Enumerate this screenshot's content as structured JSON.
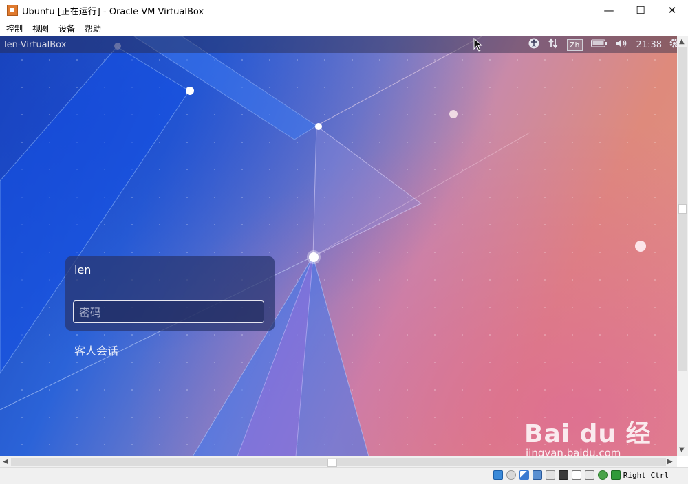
{
  "window": {
    "title": "Ubuntu [正在运行] - Oracle VM VirtualBox",
    "minimize_glyph": "—",
    "maximize_glyph": "☐",
    "close_glyph": "✕",
    "app_icon": "virtualbox-icon"
  },
  "menubar": {
    "items": [
      {
        "label": "控制"
      },
      {
        "label": "视图"
      },
      {
        "label": "设备"
      },
      {
        "label": "帮助"
      }
    ]
  },
  "vm": {
    "panel": {
      "hostname": "len-VirtualBox",
      "indicators": {
        "accessibility_icon": "accessibility-icon",
        "network_icon": "network-updown-icon",
        "keyboard_layout": "Zh",
        "battery_icon": "battery-icon",
        "volume_icon": "volume-icon",
        "clock": "21:38",
        "settings_icon": "gear-icon"
      }
    },
    "login": {
      "username": "len",
      "password_placeholder": "密码",
      "guest_session_label": "客人会话"
    },
    "watermark": {
      "brand": "Bai du 经验",
      "url": "jingyan.baidu.com"
    }
  },
  "statusbar": {
    "host_key": "Right Ctrl",
    "icons": [
      "hard-disk-icon",
      "optical-drive-icon",
      "audio-icon",
      "network-adapter-icon",
      "shared-folder-icon",
      "display-icon",
      "recording-icon",
      "usb-icon",
      "mouse-integration-icon",
      "keyboard-capture-icon"
    ]
  },
  "colors": {
    "panel_bg": "#2a2a46",
    "login_box_bg": "#28346e",
    "wallpaper_left": "#1a47b8",
    "wallpaper_right": "#e39383"
  }
}
